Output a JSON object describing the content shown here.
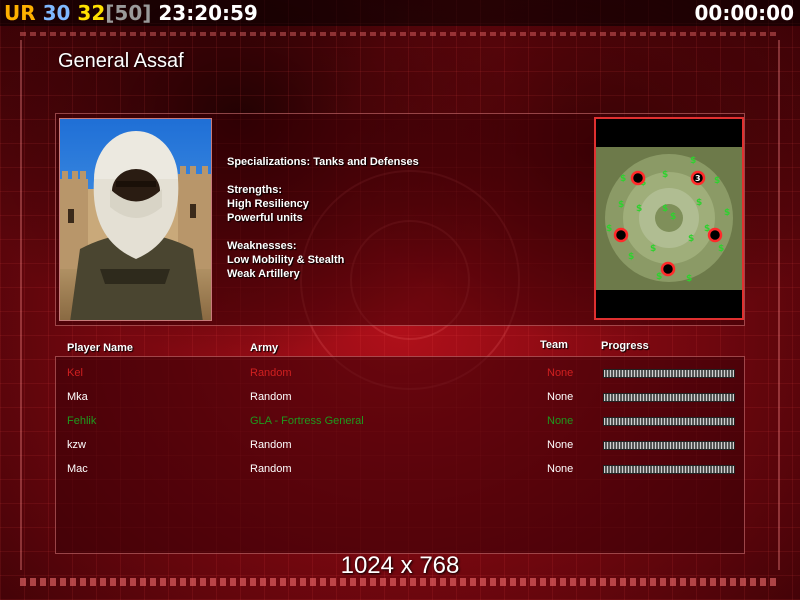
{
  "hud": {
    "ur_label": "UR",
    "fps": "30",
    "fps2": "32",
    "fps_cap": "[50]",
    "clock": "23:20:59",
    "timer": "00:00:00",
    "colors": {
      "ur": "#ffb000",
      "fps": "#7fb8ff",
      "fps2": "#ffe000",
      "fps_cap": "#9a9a9a",
      "clock": "#ffffff"
    }
  },
  "general": {
    "name": "General Assaf",
    "specializations": "Specializations: Tanks and Defenses",
    "strengths_title": "Strengths:",
    "strengths": [
      "High Resiliency",
      "Powerful units"
    ],
    "weaknesses_title": "Weaknesses:",
    "weaknesses": [
      "Low Mobility & Stealth",
      "Weak Artillery"
    ]
  },
  "table": {
    "headers": {
      "player_name": "Player Name",
      "army": "Army",
      "team": "Team",
      "progress": "Progress"
    },
    "rows": [
      {
        "name": "Kel",
        "army": "Random",
        "team": "None",
        "color": "#d02020"
      },
      {
        "name": "Mka",
        "army": "Random",
        "team": "None",
        "color": "#ffffff"
      },
      {
        "name": "Fehlik",
        "army": "GLA - Fortress General",
        "team": "None",
        "color": "#1e9a1e"
      },
      {
        "name": "kzw",
        "army": "Random",
        "team": "None",
        "color": "#ffffff"
      },
      {
        "name": "Mac",
        "army": "Random",
        "team": "None",
        "color": "#ffffff"
      }
    ]
  },
  "minimap": {
    "start_marker": "3"
  },
  "resolution": "1024 x 768"
}
